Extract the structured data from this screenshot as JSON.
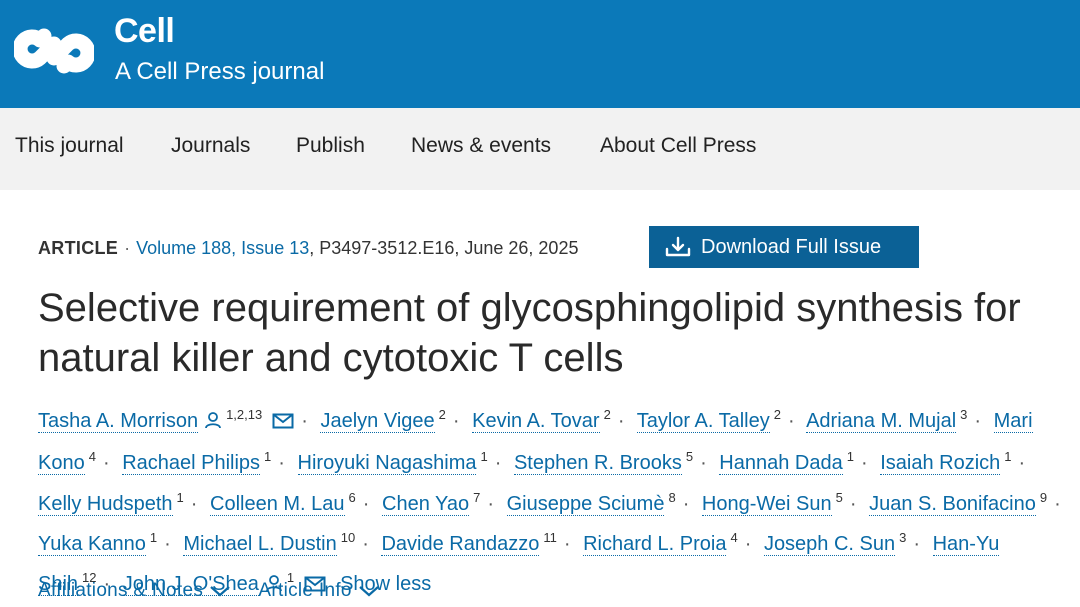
{
  "header": {
    "brand": "Cell",
    "subtitle": "A Cell Press journal",
    "logo_icon": "cell-logo-icon",
    "color": "#0b79b9"
  },
  "nav": {
    "items": [
      {
        "label": "This journal"
      },
      {
        "label": "Journals"
      },
      {
        "label": "Publish"
      },
      {
        "label": "News & events"
      },
      {
        "label": "About Cell Press"
      }
    ]
  },
  "article": {
    "type": "ARTICLE",
    "volume_issue": "Volume 188, Issue 13",
    "pages_date": "P3497-3512.E16, June 26, 2025",
    "download_label": "Download Full Issue",
    "title": "Selective requirement of glycosphingolipid synthesis for natural killer and cytotoxic T cells"
  },
  "authors": [
    {
      "name": "Tasha A. Morrison",
      "aff": "1,2,13",
      "person_icon": true,
      "email_icon": true
    },
    {
      "name": "Jaelyn Vigee",
      "aff": "2"
    },
    {
      "name": "Kevin A. Tovar",
      "aff": "2"
    },
    {
      "name": "Taylor A. Talley",
      "aff": "2"
    },
    {
      "name": "Adriana M. Mujal",
      "aff": "3"
    },
    {
      "name": "Mari Kono",
      "aff": "4"
    },
    {
      "name": "Rachael Philips",
      "aff": "1"
    },
    {
      "name": "Hiroyuki Nagashima",
      "aff": "1"
    },
    {
      "name": "Stephen R. Brooks",
      "aff": "5"
    },
    {
      "name": "Hannah Dada",
      "aff": "1"
    },
    {
      "name": "Isaiah Rozich",
      "aff": "1"
    },
    {
      "name": "Kelly Hudspeth",
      "aff": "1"
    },
    {
      "name": "Colleen M. Lau",
      "aff": "6"
    },
    {
      "name": "Chen Yao",
      "aff": "7"
    },
    {
      "name": "Giuseppe Sciumè",
      "aff": "8"
    },
    {
      "name": "Hong-Wei Sun",
      "aff": "5"
    },
    {
      "name": "Juan S. Bonifacino",
      "aff": "9"
    },
    {
      "name": "Yuka Kanno",
      "aff": "1"
    },
    {
      "name": "Michael L. Dustin",
      "aff": "10"
    },
    {
      "name": "Davide Randazzo",
      "aff": "11"
    },
    {
      "name": "Richard L. Proia",
      "aff": "4"
    },
    {
      "name": "Joseph C. Sun",
      "aff": "3"
    },
    {
      "name": "Han-Yu Shih",
      "aff": "12"
    },
    {
      "name": "John J. O'Shea",
      "aff": "1",
      "person_icon": true,
      "email_icon": true
    }
  ],
  "show_less": "Show less",
  "tabs": [
    {
      "label": "Affiliations & Notes",
      "icon": "chevron-down-icon"
    },
    {
      "label": "Article Info",
      "icon": "chevron-down-icon"
    }
  ]
}
